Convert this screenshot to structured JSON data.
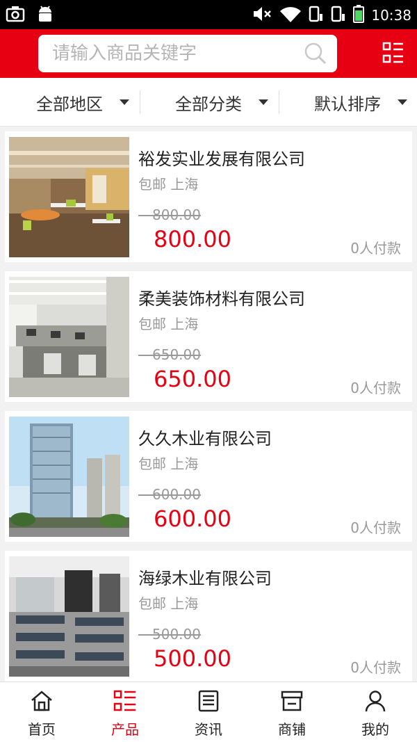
{
  "status_bar": {
    "time": "10:38"
  },
  "search": {
    "placeholder": "请输入商品关键字"
  },
  "filters": [
    {
      "label": "全部地区"
    },
    {
      "label": "全部分类"
    },
    {
      "label": "默认排序"
    }
  ],
  "products": [
    {
      "title": "裕发实业发展有限公司",
      "shipping": "包邮",
      "location": "上海",
      "original_price": "800.00",
      "price": "800.00",
      "paid": "0人付款",
      "image": "office-interior-photo"
    },
    {
      "title": "柔美装饰材料有限公司",
      "shipping": "包邮",
      "location": "上海",
      "original_price": "650.00",
      "price": "650.00",
      "paid": "0人付款",
      "image": "office-cubicles-photo"
    },
    {
      "title": "久久木业有限公司",
      "shipping": "包邮",
      "location": "上海",
      "original_price": "600.00",
      "price": "600.00",
      "paid": "0人付款",
      "image": "office-tower-photo"
    },
    {
      "title": "海绿木业有限公司",
      "shipping": "包邮",
      "location": "上海",
      "original_price": "500.00",
      "price": "500.00",
      "paid": "0人付款",
      "image": "computer-room-photo"
    }
  ],
  "tabbar": [
    {
      "label": "首页",
      "icon": "home-icon",
      "active": false
    },
    {
      "label": "产品",
      "icon": "list-icon",
      "active": true
    },
    {
      "label": "资讯",
      "icon": "news-icon",
      "active": false
    },
    {
      "label": "商铺",
      "icon": "store-icon",
      "active": false
    },
    {
      "label": "我的",
      "icon": "user-icon",
      "active": false
    }
  ],
  "colors": {
    "brand_red": "#e60012",
    "price_red": "#e60012",
    "muted_gray": "#999999"
  }
}
